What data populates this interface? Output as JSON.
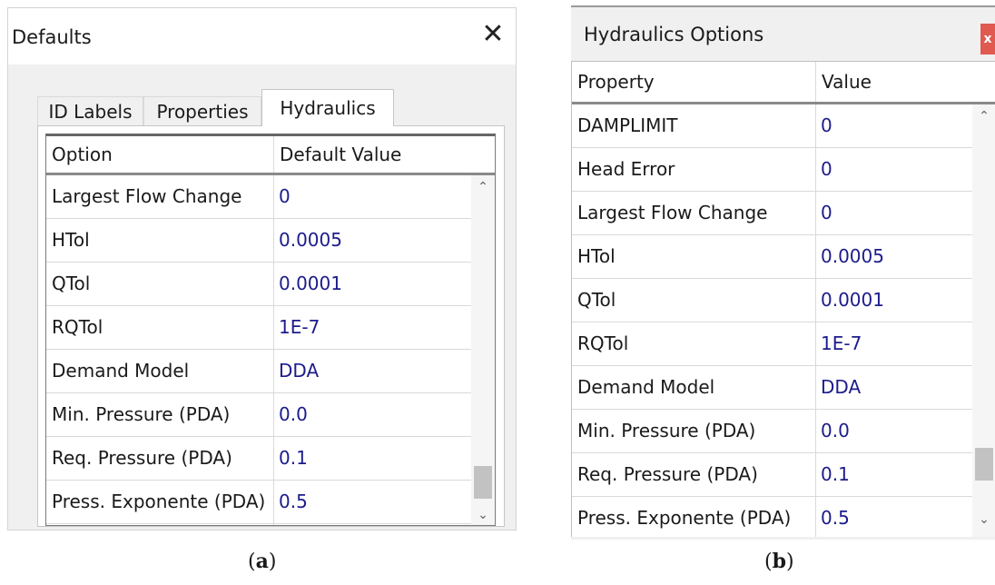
{
  "panel_a": {
    "title": "Defaults",
    "close_glyph": "✕",
    "tabs": [
      {
        "label": "ID Labels",
        "active": false
      },
      {
        "label": "Properties",
        "active": false
      },
      {
        "label": "Hydraulics",
        "active": true
      }
    ],
    "columns": [
      "Option",
      "Default Value"
    ],
    "rows": [
      {
        "option": "Largest Flow Change",
        "value": "0"
      },
      {
        "option": "HTol",
        "value": "0.0005"
      },
      {
        "option": "QTol",
        "value": "0.0001"
      },
      {
        "option": "RQTol",
        "value": "1E-7"
      },
      {
        "option": "Demand Model",
        "value": "DDA"
      },
      {
        "option": "Min. Pressure (PDA)",
        "value": "0.0"
      },
      {
        "option": "Req. Pressure (PDA)",
        "value": "0.1"
      },
      {
        "option": "Press. Exponente (PDA)",
        "value": "0.5"
      }
    ],
    "scroll_up_icon": "chevron-up-icon",
    "scroll_down_icon": "chevron-down-icon",
    "caption": {
      "open": "(",
      "letter": "a",
      "close": ")"
    }
  },
  "panel_b": {
    "title": "Hydraulics Options",
    "close_glyph": "x",
    "close_color": "#e05a4f",
    "columns": [
      "Property",
      "Value"
    ],
    "rows": [
      {
        "property": "DAMPLIMIT",
        "value": "0"
      },
      {
        "property": "Head Error",
        "value": "0"
      },
      {
        "property": "Largest Flow Change",
        "value": "0"
      },
      {
        "property": "HTol",
        "value": "0.0005"
      },
      {
        "property": "QTol",
        "value": "0.0001"
      },
      {
        "property": "RQTol",
        "value": "1E-7"
      },
      {
        "property": "Demand Model",
        "value": "DDA"
      },
      {
        "property": "Min. Pressure (PDA)",
        "value": "0.0"
      },
      {
        "property": "Req. Pressure (PDA)",
        "value": "0.1"
      },
      {
        "property": "Press. Exponente (PDA)",
        "value": "0.5"
      }
    ],
    "scroll_up_icon": "chevron-up-icon",
    "scroll_down_icon": "chevron-down-icon",
    "caption": {
      "open": "(",
      "letter": "b",
      "close": ")"
    }
  },
  "colors": {
    "value_text": "#1c1c8c",
    "dialog_bg": "#f0f0f0",
    "grid_line": "#d9d9d9",
    "scroll_thumb": "#c2c2c2"
  }
}
